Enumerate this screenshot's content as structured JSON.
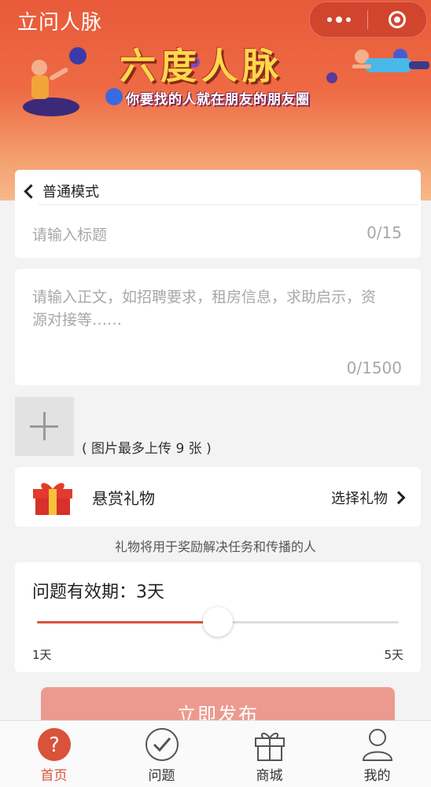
{
  "app": {
    "title": "立问人脉"
  },
  "banner": {
    "title": "六度人脉",
    "subtitle": "你要找的人就在朋友的朋友圈"
  },
  "mode": {
    "label": "普通模式"
  },
  "title_field": {
    "placeholder": "请输入标题",
    "counter": "0/15"
  },
  "body_field": {
    "placeholder": "请输入正文，如招聘要求，租房信息，求助启示，资源对接等……",
    "counter": "0/1500"
  },
  "upload": {
    "hint": "( 图片最多上传 9 张 )"
  },
  "gift": {
    "label": "悬赏礼物",
    "select_label": "选择礼物",
    "note": "礼物将用于奖励解决任务和传播的人"
  },
  "period": {
    "label": "问题有效期：3天",
    "min_label": "1天",
    "max_label": "5天",
    "value_days": 3,
    "min_days": 1,
    "max_days": 5
  },
  "publish": {
    "label": "立即发布"
  },
  "tabbar": {
    "items": [
      {
        "label": "首页",
        "icon": "question-circle-icon",
        "active": true
      },
      {
        "label": "问题",
        "icon": "check-circle-icon",
        "active": false
      },
      {
        "label": "商城",
        "icon": "gift-box-icon",
        "active": false
      },
      {
        "label": "我的",
        "icon": "user-icon",
        "active": false
      }
    ]
  },
  "colors": {
    "accent": "#d9523a",
    "header_start": "#e85a3a",
    "button_disabled": "#ec9a8f",
    "gift_red": "#e23b2e",
    "gift_gold": "#f5c23a"
  }
}
